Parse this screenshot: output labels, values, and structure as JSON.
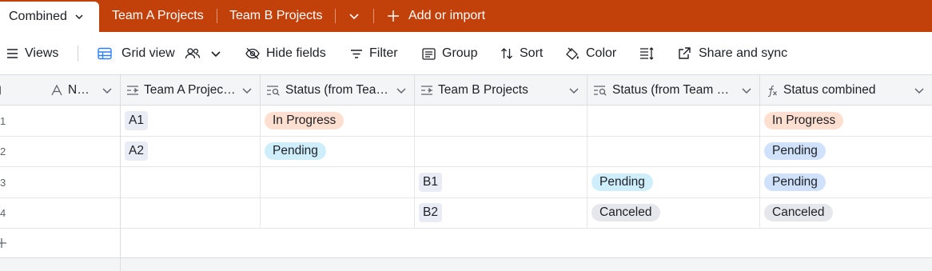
{
  "tabs": {
    "active": "Combined",
    "items": [
      "Team A Projects",
      "Team B Projects"
    ],
    "add_import": "Add or import"
  },
  "toolbar": {
    "views": "Views",
    "grid_view": "Grid view",
    "hide_fields": "Hide fields",
    "filter": "Filter",
    "group": "Group",
    "sort": "Sort",
    "color": "Color",
    "share_sync": "Share and sync"
  },
  "columns": [
    {
      "label": "N…",
      "icon": "text-icon"
    },
    {
      "label": "Team A Projec…",
      "icon": "link-icon"
    },
    {
      "label": "Status (from Tea…",
      "icon": "lookup-icon"
    },
    {
      "label": "Team B Projects",
      "icon": "link-icon"
    },
    {
      "label": "Status (from Team …",
      "icon": "lookup-icon"
    },
    {
      "label": "Status combined",
      "icon": "formula-icon"
    }
  ],
  "rows": [
    {
      "num": "1",
      "team_a": "A1",
      "status_a": "In Progress",
      "team_b": "",
      "status_b": "",
      "combined": "In Progress"
    },
    {
      "num": "2",
      "team_a": "A2",
      "status_a": "Pending",
      "team_b": "",
      "status_b": "",
      "combined": "Pending"
    },
    {
      "num": "3",
      "team_a": "",
      "status_a": "",
      "team_b": "B1",
      "status_b": "Pending",
      "combined": "Pending"
    },
    {
      "num": "4",
      "team_a": "",
      "status_a": "",
      "team_b": "B2",
      "status_b": "Canceled",
      "combined": "Canceled"
    }
  ],
  "colors": {
    "brand": "#c2410b",
    "in_progress": "#ffdfcf",
    "pending_light": "#cfeefc",
    "pending_combined": "#d0e1fb",
    "canceled": "#e5e7ec"
  }
}
